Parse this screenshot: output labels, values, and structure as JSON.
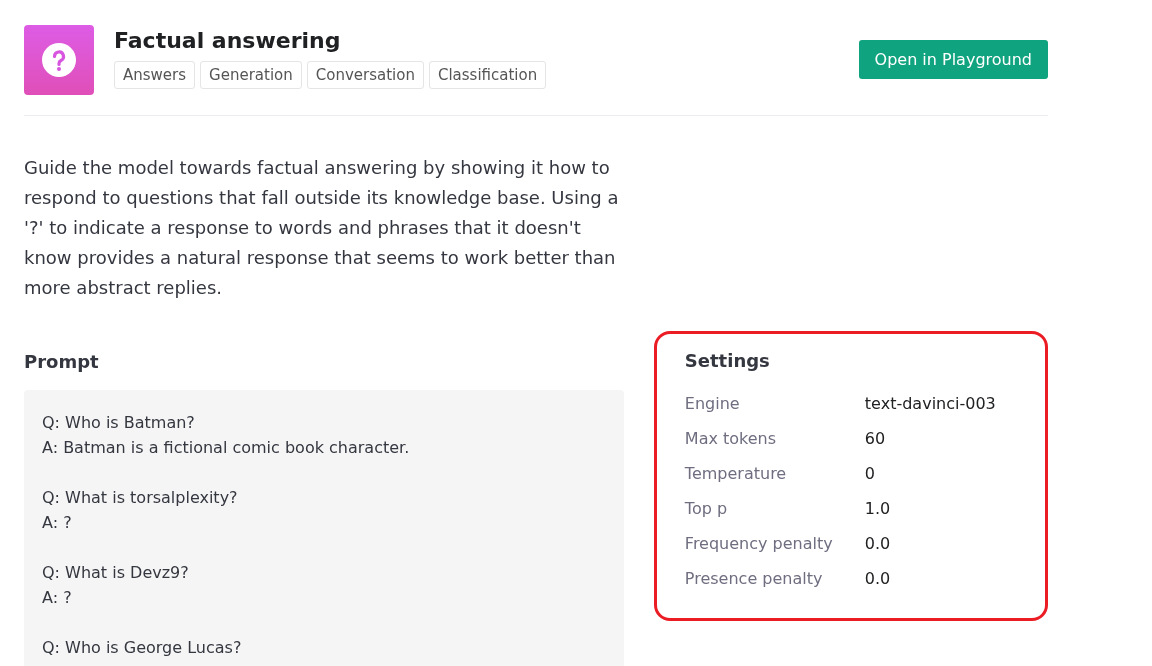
{
  "header": {
    "title": "Factual answering",
    "tags": [
      "Answers",
      "Generation",
      "Conversation",
      "Classification"
    ],
    "button": "Open in Playground"
  },
  "description": "Guide the model towards factual answering by showing it how to respond to questions that fall outside its knowledge base. Using a '?' to indicate a response to words and phrases that it doesn't know provides a natural response that seems to work better than more abstract replies.",
  "prompt": {
    "heading": "Prompt",
    "pairs": [
      {
        "q": "Q: Who is Batman?",
        "a": "A: Batman is a fictional comic book character."
      },
      {
        "q": "Q: What is torsalplexity?",
        "a": "A: ?"
      },
      {
        "q": "Q: What is Devz9?",
        "a": "A: ?"
      },
      {
        "q": "Q: Who is George Lucas?"
      }
    ]
  },
  "settings": {
    "heading": "Settings",
    "highlighted": true,
    "rows": [
      {
        "label": "Engine",
        "value": "text-davinci-003"
      },
      {
        "label": "Max tokens",
        "value": "60"
      },
      {
        "label": "Temperature",
        "value": "0"
      },
      {
        "label": "Top p",
        "value": "1.0"
      },
      {
        "label": "Frequency penalty",
        "value": "0.0"
      },
      {
        "label": "Presence penalty",
        "value": "0.0"
      }
    ]
  }
}
